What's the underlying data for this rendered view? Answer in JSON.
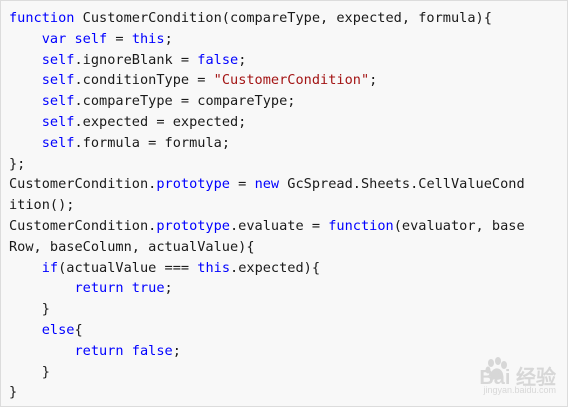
{
  "code": {
    "lines": [
      [
        {
          "t": "kw",
          "v": "function"
        },
        {
          "t": "plain",
          "v": " CustomerCondition(compareType, expected, formula){"
        }
      ],
      [
        {
          "t": "plain",
          "v": "    "
        },
        {
          "t": "kw",
          "v": "var"
        },
        {
          "t": "plain",
          "v": " "
        },
        {
          "t": "kw",
          "v": "self"
        },
        {
          "t": "plain",
          "v": " = "
        },
        {
          "t": "kw",
          "v": "this"
        },
        {
          "t": "plain",
          "v": ";"
        }
      ],
      [
        {
          "t": "plain",
          "v": "    "
        },
        {
          "t": "kw",
          "v": "self"
        },
        {
          "t": "plain",
          "v": ".ignoreBlank = "
        },
        {
          "t": "kw",
          "v": "false"
        },
        {
          "t": "plain",
          "v": ";"
        }
      ],
      [
        {
          "t": "plain",
          "v": "    "
        },
        {
          "t": "kw",
          "v": "self"
        },
        {
          "t": "plain",
          "v": ".conditionType = "
        },
        {
          "t": "str",
          "v": "\"CustomerCondition\""
        },
        {
          "t": "plain",
          "v": ";"
        }
      ],
      [
        {
          "t": "plain",
          "v": "    "
        },
        {
          "t": "kw",
          "v": "self"
        },
        {
          "t": "plain",
          "v": ".compareType = compareType;"
        }
      ],
      [
        {
          "t": "plain",
          "v": "    "
        },
        {
          "t": "kw",
          "v": "self"
        },
        {
          "t": "plain",
          "v": ".expected = expected;"
        }
      ],
      [
        {
          "t": "plain",
          "v": "    "
        },
        {
          "t": "kw",
          "v": "self"
        },
        {
          "t": "plain",
          "v": ".formula = formula;"
        }
      ],
      [
        {
          "t": "plain",
          "v": "};"
        }
      ],
      [
        {
          "t": "plain",
          "v": "CustomerCondition."
        },
        {
          "t": "kw",
          "v": "prototype"
        },
        {
          "t": "plain",
          "v": " = "
        },
        {
          "t": "kw",
          "v": "new"
        },
        {
          "t": "plain",
          "v": " GcSpread.Sheets.CellValueCond"
        }
      ],
      [
        {
          "t": "plain",
          "v": "ition();"
        }
      ],
      [
        {
          "t": "plain",
          "v": "CustomerCondition."
        },
        {
          "t": "kw",
          "v": "prototype"
        },
        {
          "t": "plain",
          "v": ".evaluate = "
        },
        {
          "t": "kw",
          "v": "function"
        },
        {
          "t": "plain",
          "v": "(evaluator, base"
        }
      ],
      [
        {
          "t": "plain",
          "v": "Row, baseColumn, actualValue){"
        }
      ],
      [
        {
          "t": "plain",
          "v": "    "
        },
        {
          "t": "kw",
          "v": "if"
        },
        {
          "t": "plain",
          "v": "(actualValue === "
        },
        {
          "t": "kw",
          "v": "this"
        },
        {
          "t": "plain",
          "v": ".expected){"
        }
      ],
      [
        {
          "t": "plain",
          "v": "        "
        },
        {
          "t": "kw",
          "v": "return"
        },
        {
          "t": "plain",
          "v": " "
        },
        {
          "t": "kw",
          "v": "true"
        },
        {
          "t": "plain",
          "v": ";"
        }
      ],
      [
        {
          "t": "plain",
          "v": "    }"
        }
      ],
      [
        {
          "t": "plain",
          "v": "    "
        },
        {
          "t": "kw",
          "v": "else"
        },
        {
          "t": "plain",
          "v": "{"
        }
      ],
      [
        {
          "t": "plain",
          "v": "        "
        },
        {
          "t": "kw",
          "v": "return"
        },
        {
          "t": "plain",
          "v": " "
        },
        {
          "t": "kw",
          "v": "false"
        },
        {
          "t": "plain",
          "v": ";"
        }
      ],
      [
        {
          "t": "plain",
          "v": "    }"
        }
      ],
      [
        {
          "t": "plain",
          "v": "}"
        }
      ]
    ]
  },
  "watermark": {
    "main": "Bai  经验",
    "sub": "jingyan.baidu.com"
  },
  "colors": {
    "keyword": "#0000ff",
    "string": "#a31515",
    "text": "#1a1a1a",
    "background": "#f8f8f8"
  }
}
